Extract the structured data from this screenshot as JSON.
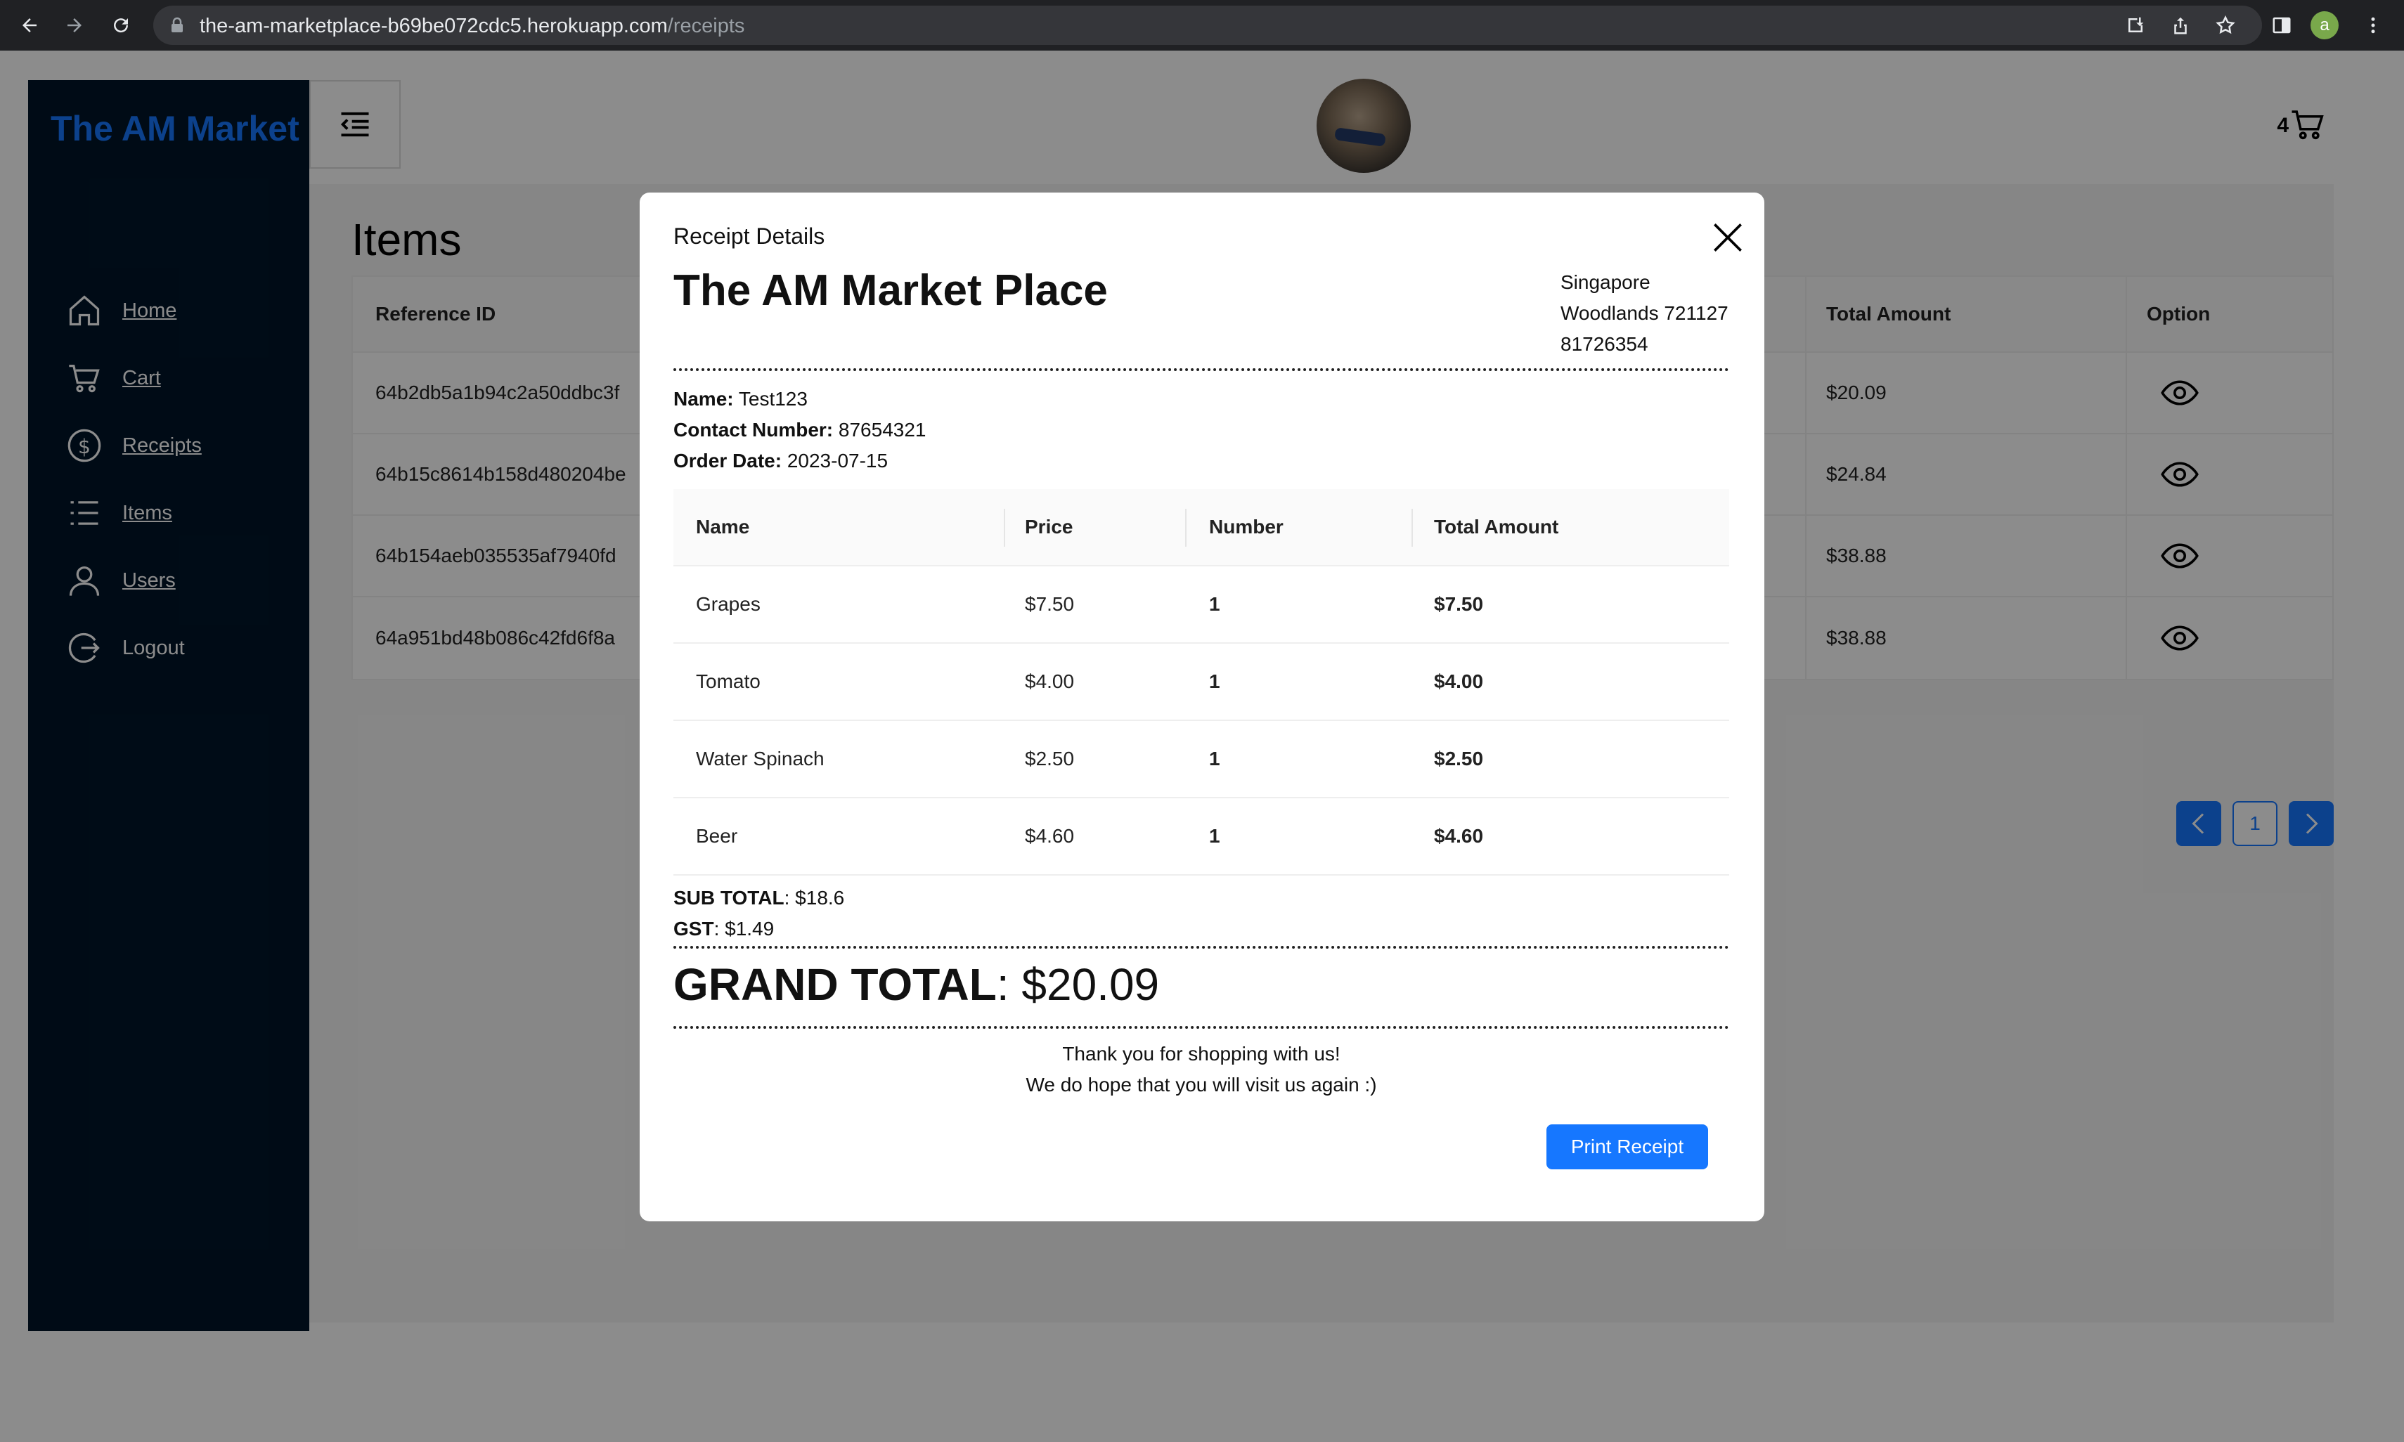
{
  "browser": {
    "url_host": "the-am-marketplace-b69be072cdc5.herokuapp.com",
    "url_path": "/receipts",
    "profile_initial": "a"
  },
  "sidebar": {
    "brand": "The AM Market",
    "items": [
      {
        "label": "Home",
        "icon": "home-icon"
      },
      {
        "label": "Cart",
        "icon": "cart-icon"
      },
      {
        "label": "Receipts",
        "icon": "dollar-icon"
      },
      {
        "label": "Items",
        "icon": "list-icon"
      },
      {
        "label": "Users",
        "icon": "user-icon"
      },
      {
        "label": "Logout",
        "icon": "logout-icon"
      }
    ]
  },
  "header": {
    "cart_count": "4"
  },
  "main": {
    "title": "Items",
    "columns": [
      "Reference ID",
      "Total Amount",
      "Option"
    ],
    "rows": [
      {
        "ref": "64b2db5a1b94c2a50ddbc3f",
        "total": "$20.09"
      },
      {
        "ref": "64b15c8614b158d480204be",
        "total": "$24.84"
      },
      {
        "ref": "64b154aeb035535af7940fd",
        "total": "$38.88"
      },
      {
        "ref": "64a951bd48b086c42fd6f8a",
        "total": "$38.88"
      }
    ],
    "page": "1"
  },
  "modal": {
    "title": "Receipt Details",
    "store_name": "The AM Market Place",
    "address": [
      "Singapore",
      "Woodlands 721127",
      "81726354"
    ],
    "name_label": "Name:",
    "name": "Test123",
    "contact_label": "Contact Number:",
    "contact": "87654321",
    "date_label": "Order Date:",
    "date": "2023-07-15",
    "columns": [
      "Name",
      "Price",
      "Number",
      "Total Amount"
    ],
    "items": [
      {
        "name": "Grapes",
        "price": "$7.50",
        "number": "1",
        "total": "$7.50"
      },
      {
        "name": "Tomato",
        "price": "$4.00",
        "number": "1",
        "total": "$4.00"
      },
      {
        "name": "Water Spinach",
        "price": "$2.50",
        "number": "1",
        "total": "$2.50"
      },
      {
        "name": "Beer",
        "price": "$4.60",
        "number": "1",
        "total": "$4.60"
      }
    ],
    "subtotal_label": "SUB TOTAL",
    "subtotal": ": $18.6",
    "gst_label": "GST",
    "gst": ": $1.49",
    "grand_label": "GRAND TOTAL",
    "grand": ": $20.09",
    "thanks1": "Thank you for shopping with us!",
    "thanks2": "We do hope that you will visit us again :)",
    "print_label": "Print Receipt"
  },
  "colors": {
    "accent": "#1677ff",
    "sidebar_bg": "#001529"
  }
}
